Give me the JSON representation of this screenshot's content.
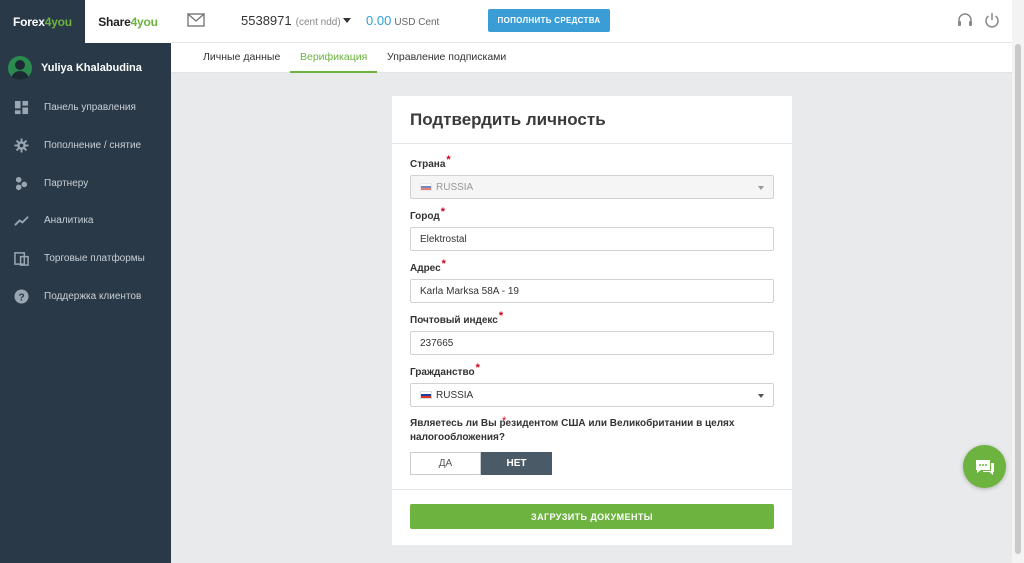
{
  "brand": {
    "forex_a": "Forex",
    "forex_b": "4you",
    "share_a": "Share",
    "share_b": "4you"
  },
  "user": {
    "name": "Yuliya Khalabudina"
  },
  "nav": [
    {
      "label": "Панель управления",
      "icon": "dashboard-icon"
    },
    {
      "label": "Пополнение / снятие",
      "icon": "gear-icon"
    },
    {
      "label": "Партнеру",
      "icon": "partner-icon"
    },
    {
      "label": "Аналитика",
      "icon": "chart-line-icon"
    },
    {
      "label": "Торговые платформы",
      "icon": "platforms-icon"
    },
    {
      "label": "Поддержка клиентов",
      "icon": "help-icon"
    }
  ],
  "topbar": {
    "account_number": "5538971",
    "account_type": "(cent ndd)",
    "balance": "0.00",
    "currency": "USD Cent",
    "deposit_label": "ПОПОЛНИТЬ СРЕДСТВА"
  },
  "tabs": [
    {
      "label": "Личные данные",
      "active": false
    },
    {
      "label": "Верификация",
      "active": true
    },
    {
      "label": "Управление подписками",
      "active": false
    }
  ],
  "form": {
    "title": "Подтвердить личность",
    "country": {
      "label": "Страна",
      "value": "RUSSIA"
    },
    "city": {
      "label": "Город",
      "value": "Elektrostal"
    },
    "address": {
      "label": "Адрес",
      "value": "Karla Marksa 58A - 19"
    },
    "postal": {
      "label": "Почтовый индекс",
      "value": "237665"
    },
    "citizenship": {
      "label": "Гражданство",
      "value": "RUSSIA"
    },
    "question": "Являетесь ли Вы резидентом США или Великобритании в целях налогообложения?",
    "yes_label": "ДА",
    "no_label": "НЕТ",
    "selected": "НЕТ",
    "upload_label": "ЗАГРУЗИТЬ ДОКУМЕНТЫ"
  },
  "required_mark": "*",
  "colors": {
    "accent_green": "#6cb33f",
    "accent_blue": "#3a9dd6",
    "sidebar": "#293948"
  }
}
